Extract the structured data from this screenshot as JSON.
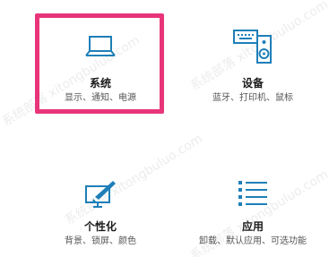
{
  "settings_tiles": [
    {
      "title": "系统",
      "description": "显示、通知、电源",
      "icon": "laptop-icon",
      "highlighted": true
    },
    {
      "title": "设备",
      "description": "蓝牙、打印机、鼠标",
      "icon": "devices-icon",
      "highlighted": false
    },
    {
      "title": "个性化",
      "description": "背景、锁屏、颜色",
      "icon": "personalization-icon",
      "highlighted": false
    },
    {
      "title": "应用",
      "description": "卸载、默认应用、可选功能",
      "icon": "apps-list-icon",
      "highlighted": false
    }
  ],
  "colors": {
    "accent_icon": "#1e7fb8",
    "highlight_border": "#e8357a"
  },
  "watermark_text": "系统部落 xitongbuluo.com"
}
